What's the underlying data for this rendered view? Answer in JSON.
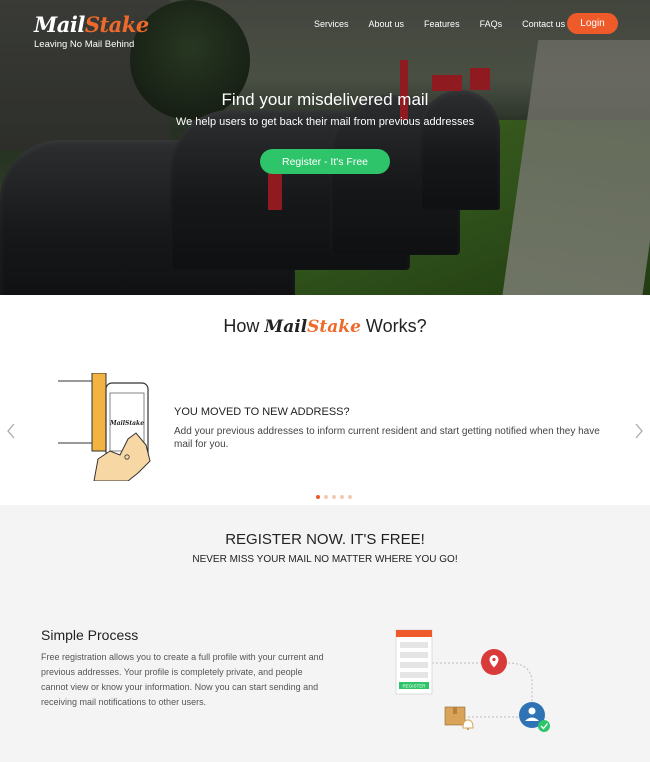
{
  "header": {
    "brand_part1": "Mail",
    "brand_part2": "Stake",
    "tagline": "Leaving No Mail Behind",
    "nav": [
      "Services",
      "About us",
      "Features",
      "FAQs",
      "Contact us"
    ],
    "login_label": "Login"
  },
  "hero": {
    "title": "Find your misdelivered mail",
    "subtitle": "We help users to get back their mail from previous addresses",
    "cta_label": "Register - It's Free"
  },
  "how": {
    "title_prefix": "How",
    "title_suffix": "Works?",
    "slide_heading": "YOU MOVED TO NEW ADDRESS?",
    "slide_text": "Add your previous addresses to inform current resident and start getting notified when they have mail for you.",
    "phone_brand": "MailStake",
    "dots": 5,
    "active_dot": 0
  },
  "register": {
    "title": "REGISTER NOW. IT'S FREE!",
    "subtitle": "NEVER MISS YOUR MAIL NO MATTER WHERE YOU GO!"
  },
  "process": {
    "title": "Simple Process",
    "text": "Free registration allows you to create a full profile with your current and previous addresses. Your profile is completely private, and people cannot view or know your information. Now you can start sending and receiving mail notifications to other users.",
    "form_button": "REGISTER"
  },
  "colors": {
    "accent": "#ef5a2a",
    "brand_orange": "#ef6a2a",
    "cta_green": "#2ec46a",
    "pin_red": "#d93a3a",
    "user_blue": "#2e74b5"
  }
}
